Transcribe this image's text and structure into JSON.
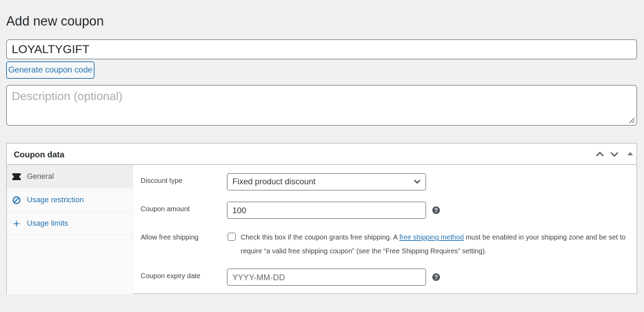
{
  "page": {
    "title": "Add new coupon"
  },
  "coupon": {
    "code_value": "LOYALTYGIFT",
    "generate_label": "Generate coupon code",
    "description_placeholder": "Description (optional)"
  },
  "panel": {
    "title": "Coupon data",
    "controls": [
      "chevron-up-icon",
      "chevron-down-icon",
      "collapse-triangle-icon"
    ]
  },
  "tabs": [
    {
      "label": "General",
      "icon": "ticket-icon",
      "active": true
    },
    {
      "label": "Usage restriction",
      "icon": "block-icon",
      "active": false
    },
    {
      "label": "Usage limits",
      "icon": "sparkle-icon",
      "active": false
    }
  ],
  "general": {
    "discount_type_label": "Discount type",
    "discount_type_value": "Fixed product discount",
    "amount_label": "Coupon amount",
    "amount_value": "100",
    "free_shipping_label": "Allow free shipping",
    "free_shipping_text_before": "Check this box if the coupon grants free shipping. A ",
    "free_shipping_link": "free shipping method",
    "free_shipping_text_after": " must be enabled in your shipping zone and be set to require “a valid free shipping coupon” (see the “Free Shipping Requires” setting).",
    "expiry_label": "Coupon expiry date",
    "expiry_placeholder": "YYYY-MM-DD"
  },
  "colors": {
    "accent": "#2271b1",
    "border": "#8c8f94",
    "background": "#f0f0f1"
  }
}
